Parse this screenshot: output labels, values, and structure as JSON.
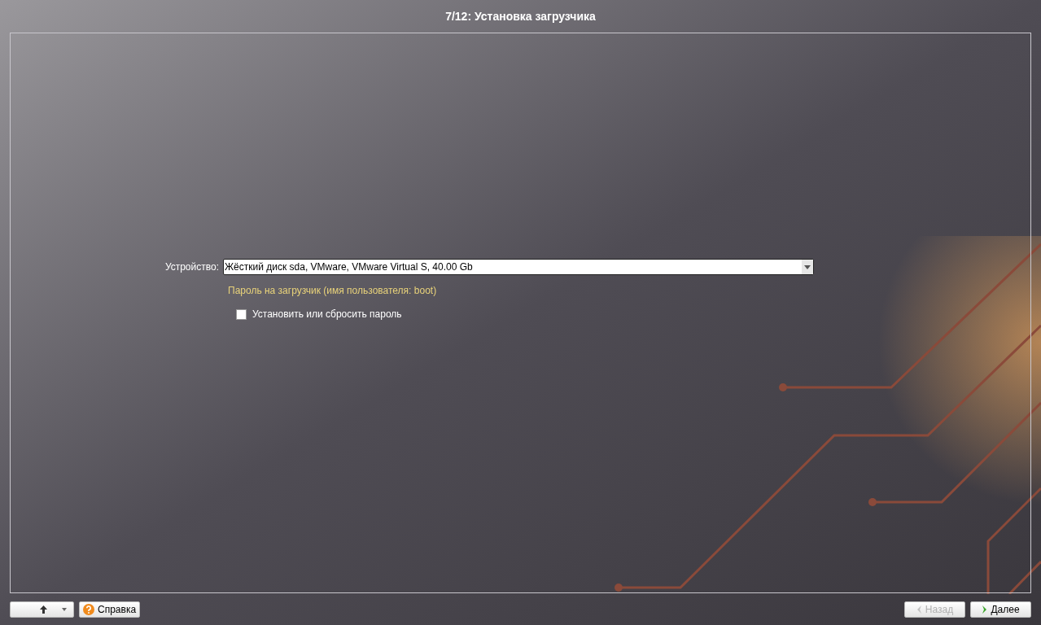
{
  "window": {
    "title": "7/12: Установка загрузчика"
  },
  "device": {
    "label": "Устройство:",
    "value": "Жёсткий диск sda, VMware, VMware Virtual S, 40.00 Gb"
  },
  "password_hint": "Пароль на загрузчик (имя пользователя: boot)",
  "password_checkbox": {
    "label": "Установить или сбросить пароль",
    "checked": false
  },
  "help_button": {
    "label": "Справка"
  },
  "back_button": {
    "label": "Назад",
    "disabled": true
  },
  "next_button": {
    "label": "Далее",
    "disabled": false
  }
}
